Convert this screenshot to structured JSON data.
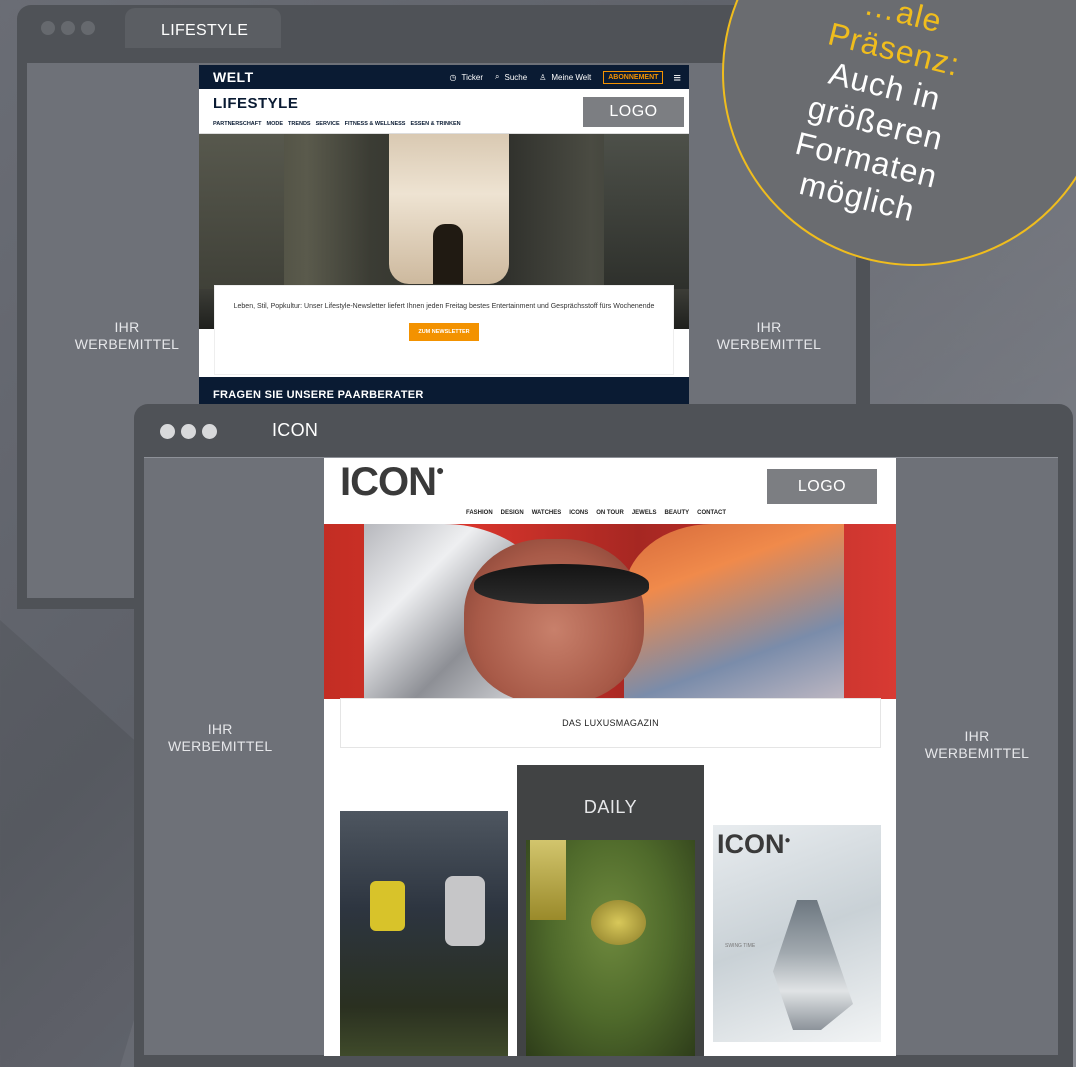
{
  "badge": {
    "line1": "…ale",
    "line2": "Präsenz:",
    "line3": "Auch in",
    "line4": "größeren",
    "line5": "Formaten",
    "line6": "möglich"
  },
  "lifestyle_window": {
    "tab_label": "LIFESTYLE",
    "ad_left": [
      "IHR",
      "WERBEMITTEL"
    ],
    "ad_right": [
      "IHR",
      "WERBEMITTEL"
    ],
    "page": {
      "brand": "WELT",
      "nav": [
        "Ticker",
        "Suche",
        "Meine Welt"
      ],
      "subscribe": "ABONNEMENT",
      "title": "LIFESTYLE",
      "categories": [
        "PARTNERSCHAFT",
        "MODE",
        "TRENDS",
        "SERVICE",
        "FITNESS & WELLNESS",
        "ESSEN & TRINKEN"
      ],
      "logo_placeholder": "LOGO",
      "newsletter_text": "Leben, Stil, Popkultur: Unser Lifestyle-Newsletter liefert Ihnen jeden Freitag bestes Entertainment und Gesprächsstoff fürs Wochenende",
      "newsletter_button": "ZUM NEWSLETTER",
      "section_heading": "FRAGEN SIE UNSERE PAARBERATER"
    }
  },
  "icon_window": {
    "tab_label": "ICON",
    "ad_left": [
      "IHR",
      "WERBEMITTEL"
    ],
    "ad_right": [
      "IHR",
      "WERBEMITTEL"
    ],
    "page": {
      "brand": "ICON",
      "logo_placeholder": "LOGO",
      "nav": [
        "FASHION",
        "DESIGN",
        "WATCHES",
        "ICONS",
        "ON TOUR",
        "JEWELS",
        "BEAUTY",
        "CONTACT"
      ],
      "caption": "DAS LUXUSMAGAZIN",
      "daily_label": "DAILY",
      "cover_brand": "ICON",
      "cover_tagline": "SWING TIME"
    }
  }
}
